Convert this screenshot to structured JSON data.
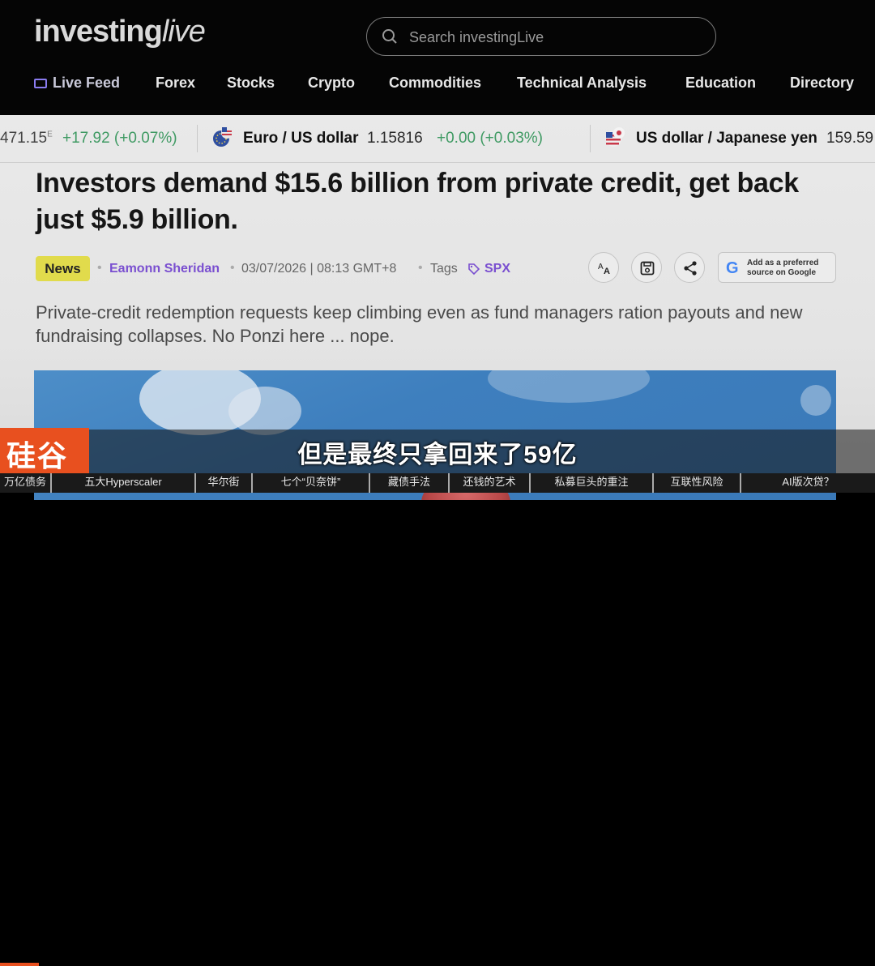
{
  "header": {
    "logo_main": "investing",
    "logo_live": "live",
    "search_placeholder": "Search investingLive",
    "nav": [
      "Live Feed",
      "Forex",
      "Stocks",
      "Crypto",
      "Commodities",
      "Technical Analysis",
      "Education",
      "Directory"
    ]
  },
  "ticker": {
    "item1": {
      "price": "471.15",
      "sup": "E",
      "change": "+17.92 (+0.07%)"
    },
    "item2": {
      "name": "Euro / US dollar",
      "price": "1.15816",
      "change": "+0.00 (+0.03%)"
    },
    "item3": {
      "name": "US dollar / Japanese yen",
      "price": "159.59"
    }
  },
  "article": {
    "title": "Investors demand $15.6 billion from private credit, get back just $5.9 billion.",
    "badge": "News",
    "author": "Eamonn Sheridan",
    "datetime": "03/07/2026 | 08:13 GMT+8",
    "tags_label": "Tags",
    "tag": "SPX",
    "google_line1": "Add as a preferred",
    "google_line2": "source on Google",
    "summary": "Private-credit redemption requests keep climbing even as fund managers ration payouts and new fundraising collapses. No Ponzi here ... nope."
  },
  "video": {
    "channel_logo": "硅谷",
    "subtitle": "但是最终只拿回来了59亿",
    "chapters": [
      "万亿债务",
      "五大Hyperscaler",
      "华尔街",
      "七个“贝奈饼”",
      "藏债手法",
      "还钱的艺术",
      "私募巨头的重注",
      "互联性风险",
      "AI版次贷？"
    ]
  },
  "colors": {
    "accent_purple": "#7a4fd0",
    "positive_green": "#3f9a63",
    "news_badge": "#e1db4c",
    "channel_orange": "#e8501f"
  }
}
